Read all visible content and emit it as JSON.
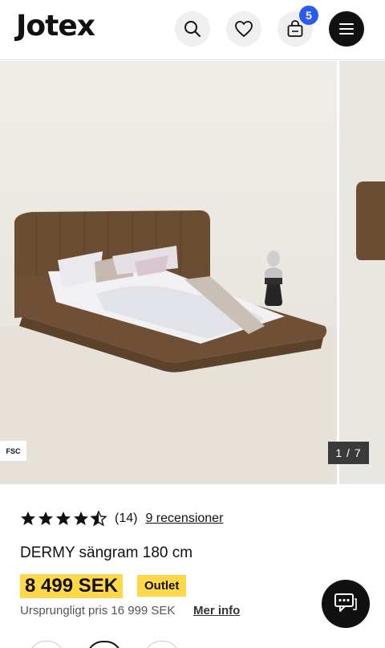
{
  "header": {
    "logo": "Jotex",
    "cart_count": "5"
  },
  "icons": {
    "search": "search-icon",
    "favorites": "heart-icon",
    "cart": "shopping-bag-icon",
    "menu": "hamburger-menu-icon",
    "chat": "chat-bubble-icon"
  },
  "gallery": {
    "badge": "FSC",
    "counter": "1 / 7"
  },
  "product": {
    "rating_value": 4.5,
    "review_count": "(14)",
    "review_link": "9 recensioner",
    "title": "DERMY sängram 180 cm",
    "price": "8 499 SEK",
    "tag": "Outlet",
    "original_price": "Ursprungligt pris 16 999 SEK",
    "more_info": "Mer info"
  },
  "colors": {
    "accent_yellow": "#ffd84a",
    "badge_blue": "#2b5bf0",
    "dark": "#111111"
  }
}
